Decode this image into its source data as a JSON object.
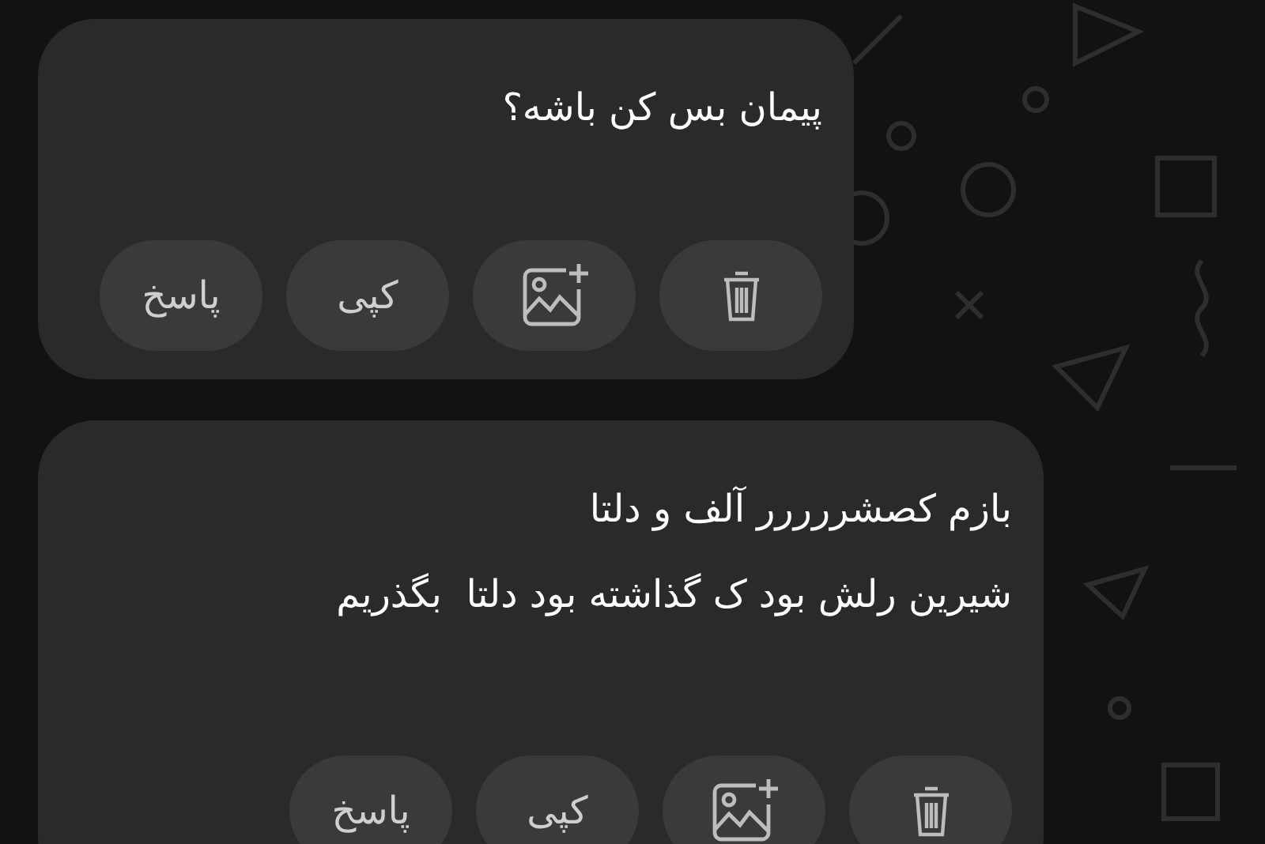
{
  "messages": [
    {
      "lines": [
        "پیمان بس کن باشه؟"
      ],
      "actions": [
        {
          "kind": "delete"
        },
        {
          "kind": "add-image"
        },
        {
          "kind": "text",
          "label": "کپی"
        },
        {
          "kind": "text",
          "label": "پاسخ"
        }
      ]
    },
    {
      "lines": [
        "بازم کصشررررر آلف و دلتا",
        "شیرین رلش بود ک گذاشته بود دلتا  بگذریم"
      ],
      "actions": [
        {
          "kind": "delete"
        },
        {
          "kind": "add-image"
        },
        {
          "kind": "text",
          "label": "کپی"
        },
        {
          "kind": "text",
          "label": "پاسخ"
        }
      ]
    }
  ]
}
